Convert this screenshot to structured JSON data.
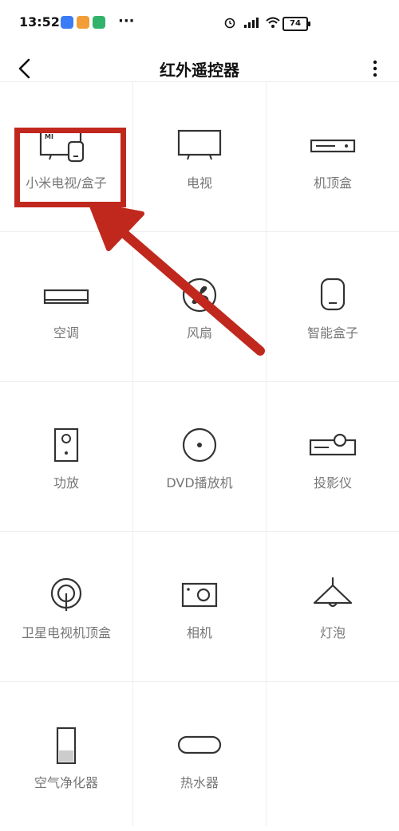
{
  "status_bar": {
    "time": "13:52",
    "battery": "74",
    "notification_icons": [
      "n-app-icon",
      "orange-app-icon",
      "green-app-icon"
    ],
    "more": "···"
  },
  "header": {
    "title": "红外遥控器",
    "back_icon": "chevron-left-icon",
    "menu_icon": "more-vertical-icon"
  },
  "devices": [
    {
      "label": "小米电视/盒子",
      "icon": "mi-tv-box-icon"
    },
    {
      "label": "电视",
      "icon": "tv-icon"
    },
    {
      "label": "机顶盒",
      "icon": "set-top-box-icon"
    },
    {
      "label": "空调",
      "icon": "air-conditioner-icon"
    },
    {
      "label": "风扇",
      "icon": "fan-icon"
    },
    {
      "label": "智能盒子",
      "icon": "smart-box-icon"
    },
    {
      "label": "功放",
      "icon": "speaker-icon"
    },
    {
      "label": "DVD播放机",
      "icon": "dvd-icon"
    },
    {
      "label": "投影仪",
      "icon": "projector-icon"
    },
    {
      "label": "卫星电视机顶盒",
      "icon": "satellite-icon"
    },
    {
      "label": "相机",
      "icon": "camera-icon"
    },
    {
      "label": "灯泡",
      "icon": "lamp-icon"
    },
    {
      "label": "空气净化器",
      "icon": "air-purifier-icon"
    },
    {
      "label": "热水器",
      "icon": "water-heater-icon"
    }
  ],
  "mi_badge": "MI",
  "colors": {
    "annotation_red": "#c0281e",
    "icon_dark": "#333333",
    "label_gray": "#777777"
  }
}
